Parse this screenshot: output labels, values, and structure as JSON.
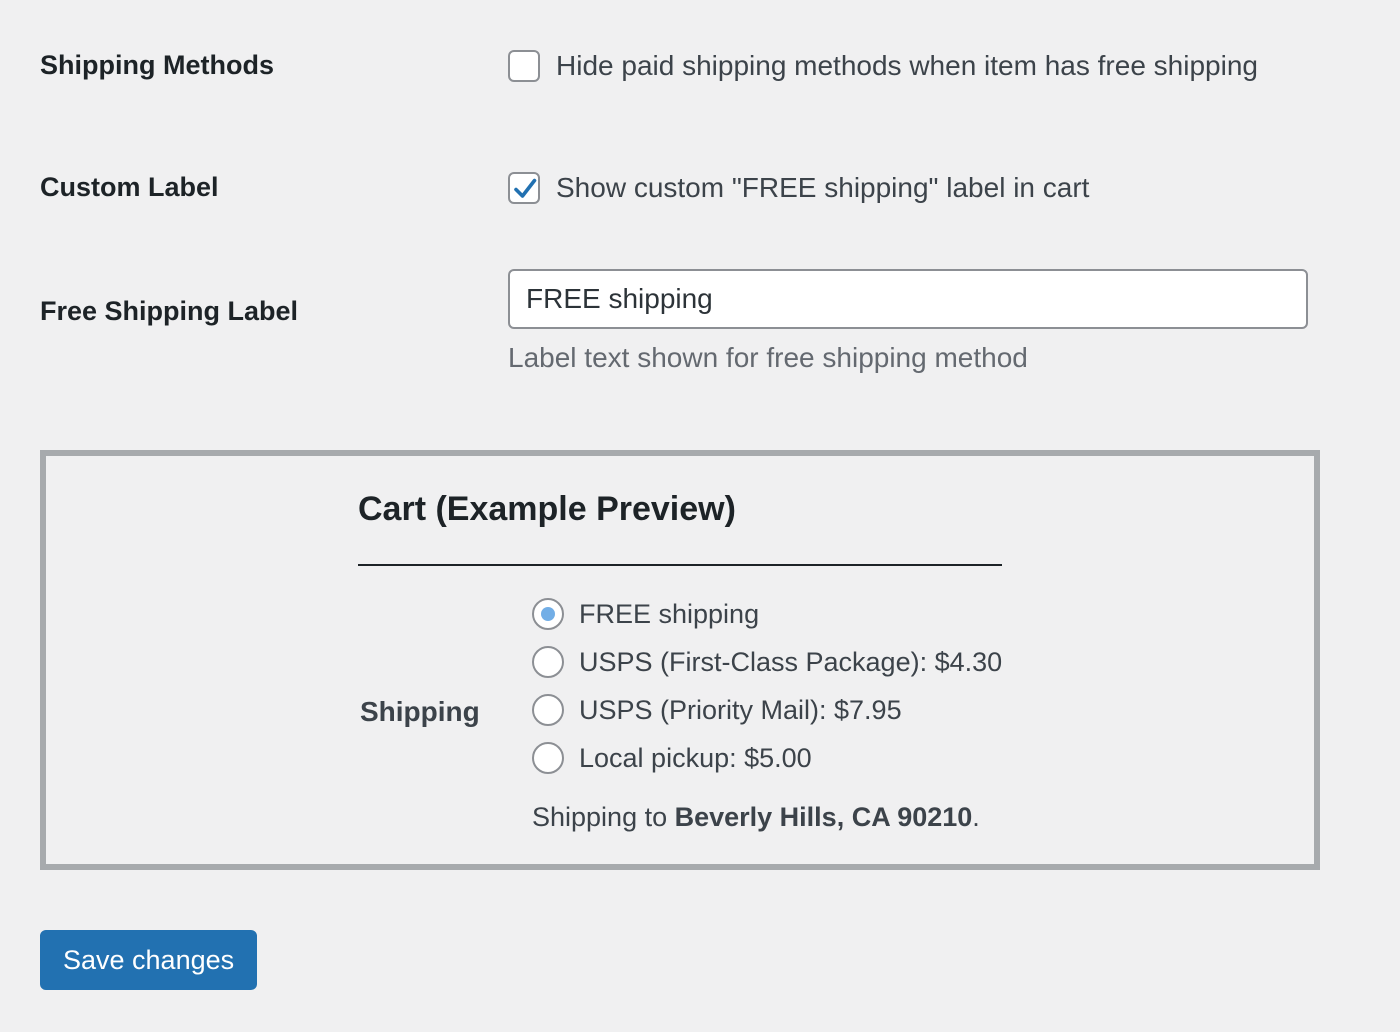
{
  "settings": {
    "shipping_methods": {
      "label": "Shipping Methods",
      "checkbox_label": "Hide paid shipping methods when item has free shipping",
      "checked": false
    },
    "custom_label": {
      "label": "Custom Label",
      "checkbox_label": "Show custom \"FREE shipping\" label in cart",
      "checked": true
    },
    "free_shipping_label": {
      "label": "Free Shipping Label",
      "value": "FREE shipping",
      "helper": "Label text shown for free shipping method"
    }
  },
  "preview": {
    "title": "Cart (Example Preview)",
    "shipping_label": "Shipping",
    "options": [
      {
        "label": "FREE shipping",
        "selected": true
      },
      {
        "label": "USPS (First-Class Package): $4.30",
        "selected": false
      },
      {
        "label": "USPS (Priority Mail): $7.95",
        "selected": false
      },
      {
        "label": "Local pickup: $5.00",
        "selected": false
      }
    ],
    "ship_to_prefix": "Shipping to ",
    "ship_to_location": "Beverly Hills, CA 90210",
    "ship_to_suffix": "."
  },
  "actions": {
    "save_label": "Save changes"
  },
  "colors": {
    "accent": "#2271b1",
    "checkmark": "#2271b1",
    "radio_dot": "#72aee6",
    "background": "#f0f0f1"
  },
  "icons": {
    "checkbox_checked": "checkmark-icon"
  }
}
